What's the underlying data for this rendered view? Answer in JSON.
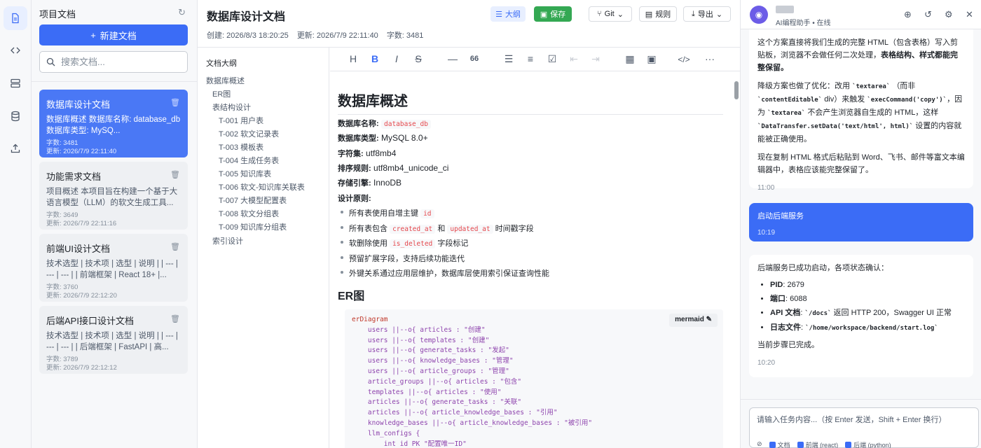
{
  "rail": {
    "icons": [
      "document-icon",
      "code-icon",
      "server-icon",
      "database-icon",
      "upload-icon"
    ]
  },
  "doclist": {
    "title": "项目文档",
    "new_label": "新建文档",
    "search_placeholder": "搜索文档...",
    "cards": [
      {
        "title": "数据库设计文档",
        "excerpt": "数据库概述 数据库名称: database_db 数据库类型: MySQ...",
        "chars": "字数: 3481",
        "updated": "更新: 2026/7/9 22:11:40"
      },
      {
        "title": "功能需求文档",
        "excerpt": "项目概述 本项目旨在构建一个基于大语言模型（LLM）的软文生成工具...",
        "chars": "字数: 3649",
        "updated": "更新: 2026/7/9 22:11:16"
      },
      {
        "title": "前端UI设计文档",
        "excerpt": "技术选型 | 技术项 | 选型 | 说明 | | --- | --- | --- | | 前端框架 | React 18+ |...",
        "chars": "字数: 3760",
        "updated": "更新: 2026/7/9 22:12:20"
      },
      {
        "title": "后端API接口设计文档",
        "excerpt": "技术选型 | 技术项 | 选型 | 说明 | | --- | --- | --- | | 后端框架 | FastAPI | 高...",
        "chars": "字数: 3789",
        "updated": "更新: 2026/7/9 22:12:12"
      }
    ]
  },
  "main": {
    "title": "数据库设计文档",
    "created": "创建: 2026/8/3 18:20:25",
    "updated": "更新: 2026/7/9 22:11:40",
    "chars": "字数: 3481",
    "buttons": {
      "outline": "大纲",
      "save": "保存",
      "git": "Git",
      "rules": "规则",
      "export": "导出"
    },
    "outline_title": "文档大纲",
    "outline": [
      "数据库概述",
      "ER图",
      "表结构设计",
      "T-001 用户表",
      "T-002 软文记录表",
      "T-003 模板表",
      "T-004 生成任务表",
      "T-005 知识库表",
      "T-006 软文-知识库关联表",
      "T-007 大模型配置表",
      "T-008 软文分组表",
      "T-009 知识库分组表",
      "索引设计"
    ],
    "toolbar": [
      "H",
      "B",
      "I",
      "S",
      "—",
      "66",
      "☰",
      "≡",
      "☑",
      "⇤",
      "⇥",
      "▦",
      "▣",
      "</>",
      "···"
    ],
    "h1": "数据库概述",
    "db_name_label": "数据库名称:",
    "db_name": "database_db",
    "db_type_label": "数据库类型:",
    "db_type": "MySQL 8.0+",
    "charset_label": "字符集:",
    "charset": "utf8mb4",
    "collation_label": "排序规则:",
    "collation": "utf8mb4_unicode_ci",
    "engine_label": "存储引擎:",
    "engine": "InnoDB",
    "principles_label": "设计原则:",
    "p1_a": "所有表使用自增主键",
    "p1_code": "id",
    "p2_a": "所有表包含",
    "p2_code1": "created_at",
    "p2_b": "和",
    "p2_code2": "updated_at",
    "p2_c": "时间戳字段",
    "p3_a": "软删除使用",
    "p3_code": "is_deleted",
    "p3_b": "字段标记",
    "p4": "预留扩展字段，支持后续功能迭代",
    "p5": "外键关系通过应用层维护，数据库层使用索引保证查询性能",
    "h2": "ER图",
    "mermaid_badge": "mermaid",
    "mermaid_lines": [
      "erDiagram",
      "    users ||--o{ articles : \"创建\"",
      "    users ||--o{ templates : \"创建\"",
      "    users ||--o{ generate_tasks : \"发起\"",
      "    users ||--o{ knowledge_bases : \"管理\"",
      "    users ||--o{ article_groups : \"管理\"",
      "    article_groups ||--o{ articles : \"包含\"",
      "    templates ||--o{ articles : \"使用\"",
      "    articles ||--o{ generate_tasks : \"关联\"",
      "    articles ||--o{ article_knowledge_bases : \"引用\"",
      "    knowledge_bases ||--o{ article_knowledge_bases : \"被引用\"",
      "    llm_configs {",
      "        int id PK \"配置唯一ID\""
    ]
  },
  "chat": {
    "status": "AI编程助手 • 在线",
    "msg1_p1": "这个方案直接将我们生成的完整 HTML（包含表格）写入剪贴板，浏览器不会做任何二次处理，",
    "msg1_p1b": "表格结构、样式都能完整保留。",
    "msg1_p2a": "降级方案也做了优化：改用",
    "msg1_p2c1": "`textarea`",
    "msg1_p2b": "（而非",
    "msg1_p2c2": "`contentEditable`",
    "msg1_p2d": "div）来触发",
    "msg1_p2c3": "`execCommand('copy')`",
    "msg1_p2e": "，因为",
    "msg1_p2c4": "`textarea`",
    "msg1_p2f": "不会产生浏览器自生成的 HTML，这样",
    "msg1_p2c5": "`DataTransfer.setData('text/html', html)`",
    "msg1_p2g": "设置的内容就能被正确使用。",
    "msg1_p3": "现在复制 HTML 格式后粘贴到 Word、飞书、邮件等富文本编辑器中，表格应该能完整保留了。",
    "msg1_time": "11:00",
    "msg2": "启动后端服务",
    "msg2_time": "10:19",
    "msg3_intro": "后端服务已成功启动，各项状态确认：",
    "msg3_pid_l": "PID",
    "msg3_pid": ": 2679",
    "msg3_port_l": "端口",
    "msg3_port": ": 6088",
    "msg3_api_l": "API 文档",
    "msg3_api_c": "`/docs`",
    "msg3_api": "返回 HTTP 200，Swagger UI 正常",
    "msg3_log_l": "日志文件",
    "msg3_log_c": "`/home/workspace/backend/start.log`",
    "msg3_done": "当前步骤已完成。",
    "msg3_time": "10:20",
    "input_placeholder": "请输入任务内容...（按 Enter 发送，Shift + Enter 换行）",
    "ctx": [
      "文档",
      "前端 (react)",
      "后端 (python)"
    ]
  }
}
